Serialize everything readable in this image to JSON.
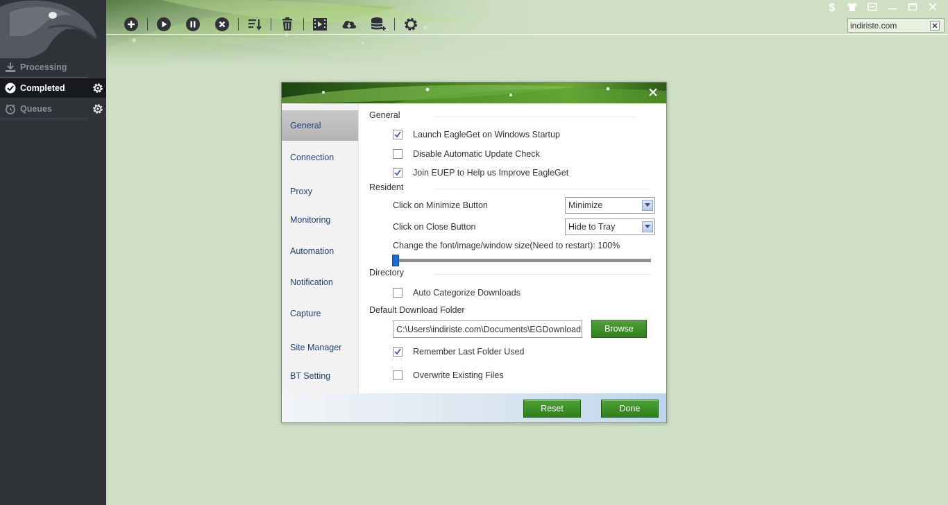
{
  "sidebar": {
    "items": [
      {
        "label": "Processing",
        "icon": "download-icon"
      },
      {
        "label": "Completed",
        "icon": "check-circle-icon"
      },
      {
        "label": "Queues",
        "icon": "alarm-clock-icon"
      }
    ]
  },
  "toolbar": {
    "buttons": [
      "add-task",
      "start",
      "pause",
      "stop",
      "sort",
      "delete",
      "video",
      "cloud-download",
      "database",
      "settings"
    ]
  },
  "search": {
    "value": "indiriste.com"
  },
  "window_controls": [
    "dollar",
    "skin",
    "mini-mode",
    "minimize",
    "maximize",
    "close"
  ],
  "dialog": {
    "nav": [
      "General",
      "Connection",
      "Proxy",
      "Monitoring",
      "Automation",
      "Notification",
      "Capture",
      "Site Manager",
      "BT Setting"
    ],
    "sections": {
      "general": "General",
      "resident": "Resident",
      "directory": "Directory",
      "default_folder": "Default Download Folder"
    },
    "general_options": [
      {
        "label": "Launch EagleGet on Windows Startup",
        "checked": true
      },
      {
        "label": "Disable Automatic Update Check",
        "checked": false
      },
      {
        "label": "Join EUEP to Help us Improve EagleGet",
        "checked": true
      }
    ],
    "resident": {
      "minimize_label": "Click on Minimize Button",
      "minimize_value": "Minimize",
      "close_label": "Click on Close Button",
      "close_value": "Hide to Tray",
      "size_label": "Change the font/image/window size(Need to restart): 100%",
      "size_percent": 100
    },
    "directory": {
      "auto_categorize": {
        "label": "Auto Categorize Downloads",
        "checked": false
      },
      "folder_path": "C:\\Users\\indiriste.com\\Documents\\EGDownloads",
      "browse_label": "Browse",
      "remember_last": {
        "label": "Remember Last Folder Used",
        "checked": true
      },
      "overwrite": {
        "label": "Overwrite Existing Files",
        "checked": false
      }
    },
    "buttons": {
      "reset": "Reset",
      "done": "Done"
    }
  },
  "colors": {
    "sidebar_bg": "#2f3338",
    "background": "#cfdfc4",
    "nav_text": "#1f3f77",
    "button_green": "#3a8b24",
    "slider_blue": "#1a6ed0"
  }
}
